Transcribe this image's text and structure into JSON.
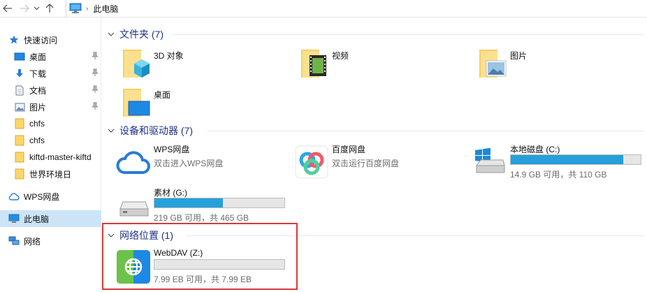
{
  "address_bar": {
    "breadcrumb": "此电脑"
  },
  "sidebar": {
    "quick_access": "快速访问",
    "pinned": [
      "桌面",
      "下载",
      "文档",
      "图片"
    ],
    "folders": [
      "chfs",
      "chfs",
      "kiftd-master-kiftd",
      "世界环境日"
    ],
    "wps": "WPS网盘",
    "this_pc": "此电脑",
    "network": "网络"
  },
  "groups": {
    "folders_header": "文件夹 (7)",
    "devices_header": "设备和驱动器 (7)",
    "network_header": "网络位置 (1)"
  },
  "folders": [
    "3D 对象",
    "视频",
    "图片",
    "桌面"
  ],
  "devices": [
    {
      "name": "WPS网盘",
      "sub": "双击进入WPS网盘"
    },
    {
      "name": "百度网盘",
      "sub": "双击运行百度网盘"
    },
    {
      "name": "本地磁盘 (C:)",
      "usage": "14.9 GB 可用，共 110 GB",
      "used_fraction": 0.865
    },
    {
      "name": "素材 (G:)",
      "usage": "219 GB 可用，共 465 GB",
      "used_fraction": 0.529
    }
  ],
  "network_locations": [
    {
      "name": "WebDAV (Z:)",
      "usage": "7.99 EB 可用，共 7.99 EB",
      "used_fraction": 0.0
    }
  ],
  "colors": {
    "selection": "#cce4f7",
    "group_header": "#1e3287",
    "bar_fill": "#26a0da",
    "highlight": "#d9393a"
  }
}
